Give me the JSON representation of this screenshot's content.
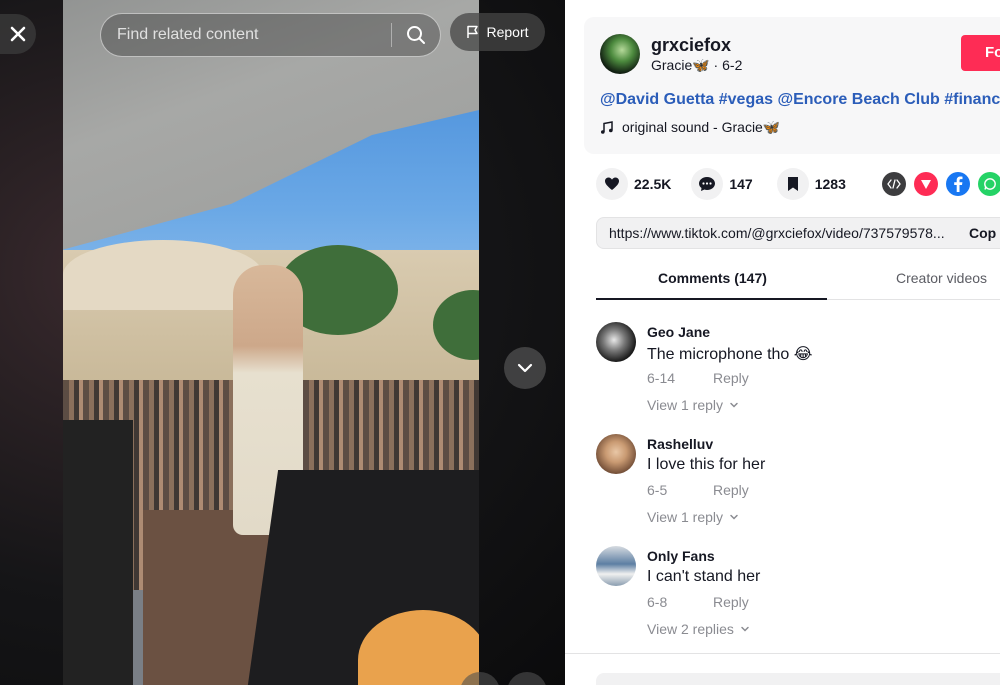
{
  "video": {
    "search_placeholder": "Find related content",
    "report_label": "Report"
  },
  "author": {
    "username": "grxciefox",
    "nickname": "Gracie",
    "nickname_emoji": "🦋",
    "post_date": "6-2",
    "follow_label": "Fo"
  },
  "caption": {
    "tags": [
      "@David Guetta",
      "#vegas",
      "@Encore Beach Club",
      "#finance"
    ]
  },
  "sound": {
    "label": "original sound - Gracie",
    "emoji": "🦋"
  },
  "stats": {
    "likes": "22.5K",
    "comments": "147",
    "saves": "1283"
  },
  "share": {
    "link": "https://www.tiktok.com/@grxciefox/video/737579578...",
    "copy_label": "Cop"
  },
  "tabs": {
    "comments": "Comments (147)",
    "creator_videos": "Creator videos"
  },
  "comments": [
    {
      "name": "Geo Jane",
      "text": "The microphone tho 😂",
      "date": "6-14",
      "reply_label": "Reply",
      "view_replies": "View 1 reply"
    },
    {
      "name": "Rashelluv",
      "text": "I love this for her",
      "date": "6-5",
      "reply_label": "Reply",
      "view_replies": "View 1 reply"
    },
    {
      "name": "Only Fans",
      "text": "I can't stand her",
      "date": "6-8",
      "reply_label": "Reply",
      "view_replies": "View 2 replies"
    }
  ],
  "colors": {
    "brand_red": "#fe2c55",
    "hashtag_blue": "#2b5db9"
  }
}
